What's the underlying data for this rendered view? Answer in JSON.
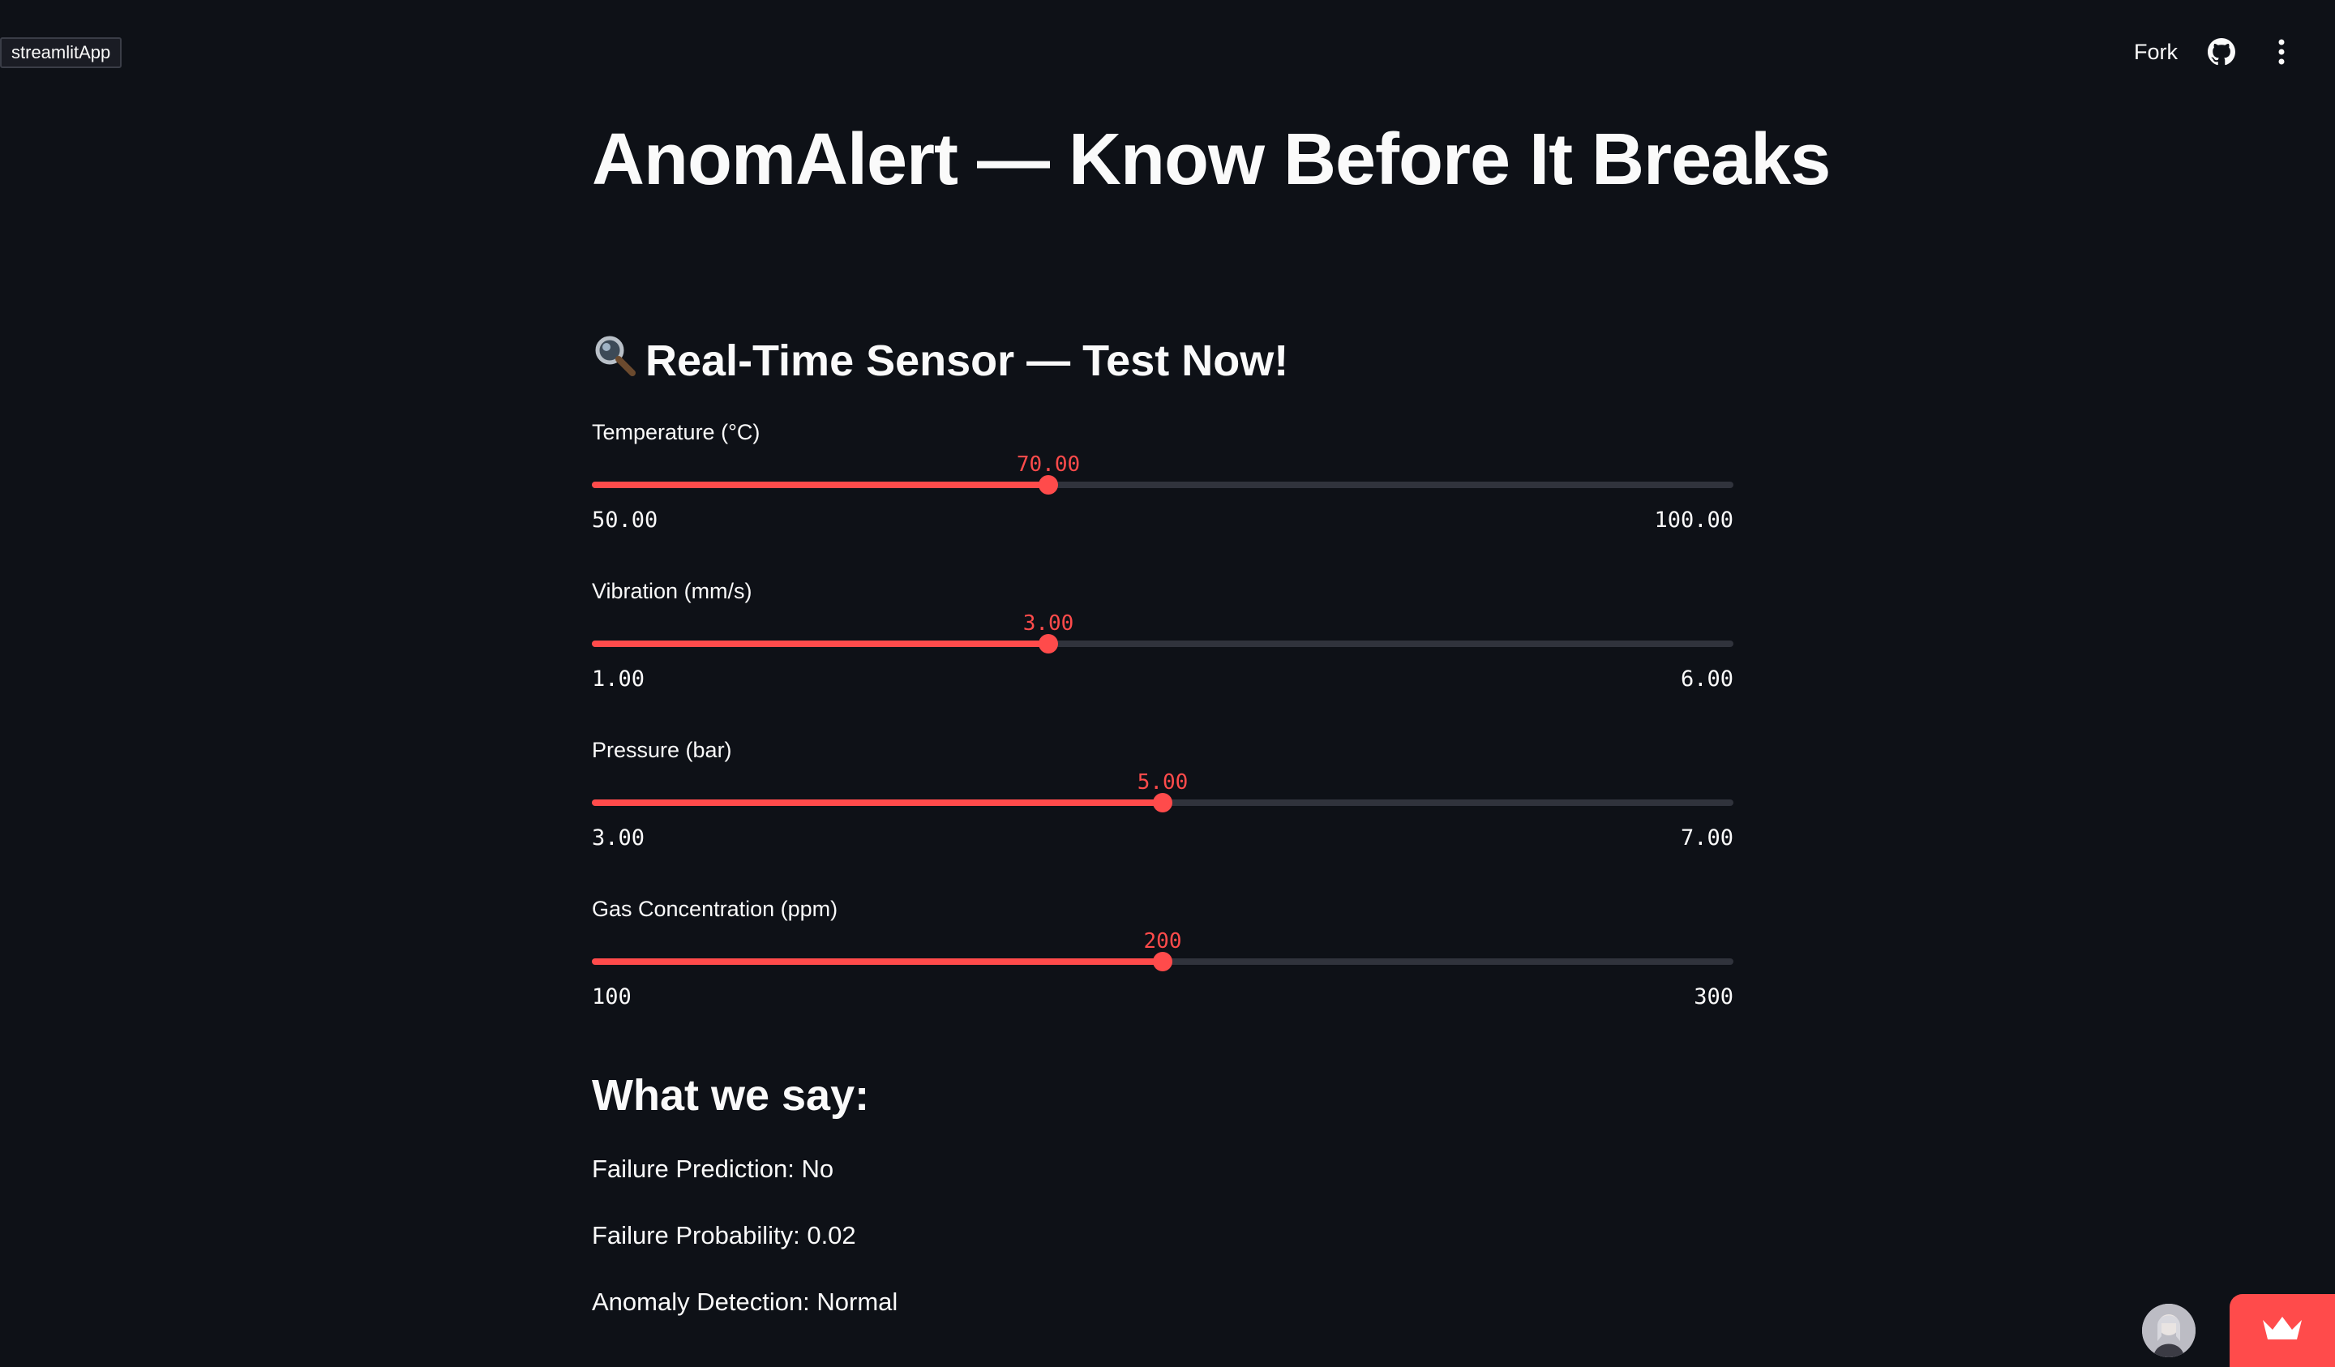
{
  "app_tag": "streamlitApp",
  "toolbar": {
    "fork_label": "Fork",
    "github_icon": "github-icon",
    "menu_icon": "kebab-menu-icon"
  },
  "page": {
    "title": "AnomAlert — Know Before It Breaks",
    "section_icon": "magnifier-icon",
    "section_title": "Real-Time Sensor — Test Now!"
  },
  "sliders": [
    {
      "label": "Temperature (°C)",
      "value": "70.00",
      "min": "50.00",
      "max": "100.00",
      "fraction": 0.4
    },
    {
      "label": "Vibration (mm/s)",
      "value": "3.00",
      "min": "1.00",
      "max": "6.00",
      "fraction": 0.4
    },
    {
      "label": "Pressure (bar)",
      "value": "5.00",
      "min": "3.00",
      "max": "7.00",
      "fraction": 0.5
    },
    {
      "label": "Gas Concentration (ppm)",
      "value": "200",
      "min": "100",
      "max": "300",
      "fraction": 0.5
    }
  ],
  "results": {
    "heading": "What we say:",
    "failure_prediction": "Failure Prediction: No",
    "failure_probability": "Failure Probability: 0.02",
    "anomaly_detection": "Anomaly Detection: Normal"
  },
  "colors": {
    "background": "#0e1117",
    "accent": "#ff4b4b",
    "track": "#30333c",
    "text": "#fafafa"
  }
}
